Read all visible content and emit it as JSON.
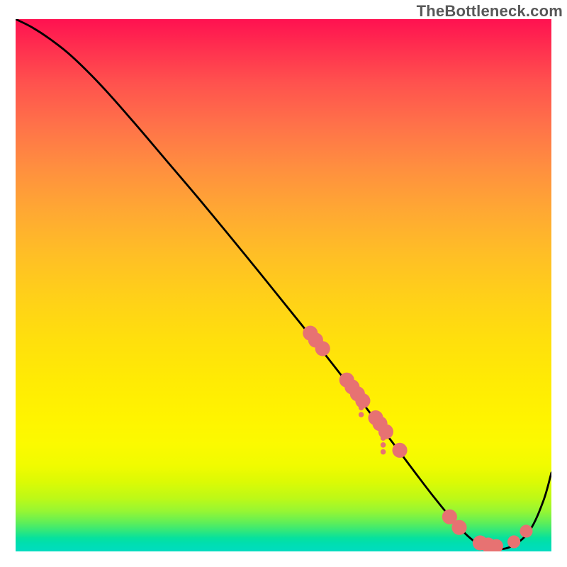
{
  "watermark": "TheBottleneck.com",
  "chart_data": {
    "type": "line",
    "title": "",
    "xlabel": "",
    "ylabel": "",
    "xlim": [
      0,
      1
    ],
    "ylim": [
      0,
      1
    ],
    "background_gradient": {
      "direction": "vertical_top_to_bottom",
      "stops": [
        {
          "pos": 0.0,
          "color": "#ff1150"
        },
        {
          "pos": 0.05,
          "color": "#ff2d4f"
        },
        {
          "pos": 0.12,
          "color": "#ff524e"
        },
        {
          "pos": 0.2,
          "color": "#ff7249"
        },
        {
          "pos": 0.28,
          "color": "#ff8f3f"
        },
        {
          "pos": 0.36,
          "color": "#ffa833"
        },
        {
          "pos": 0.44,
          "color": "#ffbe26"
        },
        {
          "pos": 0.52,
          "color": "#ffd019"
        },
        {
          "pos": 0.6,
          "color": "#ffdf0d"
        },
        {
          "pos": 0.68,
          "color": "#ffeb04"
        },
        {
          "pos": 0.75,
          "color": "#fff400"
        },
        {
          "pos": 0.8,
          "color": "#fbfa00"
        },
        {
          "pos": 0.84,
          "color": "#f0fb00"
        },
        {
          "pos": 0.87,
          "color": "#dbfa05"
        },
        {
          "pos": 0.9,
          "color": "#bdf917"
        },
        {
          "pos": 0.925,
          "color": "#95f634"
        },
        {
          "pos": 0.945,
          "color": "#61ef57"
        },
        {
          "pos": 0.962,
          "color": "#2fe77d"
        },
        {
          "pos": 0.975,
          "color": "#06e19e"
        },
        {
          "pos": 0.985,
          "color": "#00deb0"
        },
        {
          "pos": 1.0,
          "color": "#00dcc0"
        }
      ]
    },
    "series": [
      {
        "name": "bottleneck-curve",
        "color": "#000000",
        "stroke_width": 2.8,
        "x": [
          0.0,
          0.03,
          0.065,
          0.105,
          0.16,
          0.22,
          0.28,
          0.34,
          0.4,
          0.46,
          0.52,
          0.555,
          0.59,
          0.63,
          0.67,
          0.71,
          0.745,
          0.78,
          0.815,
          0.845,
          0.87,
          0.9,
          0.93,
          0.96,
          0.985,
          1.0
        ],
        "y": [
          1.0,
          0.985,
          0.962,
          0.93,
          0.875,
          0.807,
          0.736,
          0.665,
          0.592,
          0.518,
          0.443,
          0.399,
          0.354,
          0.302,
          0.249,
          0.196,
          0.149,
          0.103,
          0.06,
          0.028,
          0.011,
          0.004,
          0.012,
          0.04,
          0.095,
          0.148
        ]
      }
    ],
    "points": [
      {
        "name": "cluster-a-1",
        "x": 0.55,
        "y": 0.41,
        "r": 0.014,
        "color": "#e77272"
      },
      {
        "name": "cluster-a-2",
        "x": 0.56,
        "y": 0.397,
        "r": 0.014,
        "color": "#e77272"
      },
      {
        "name": "cluster-a-3",
        "x": 0.573,
        "y": 0.381,
        "r": 0.014,
        "color": "#e77272"
      },
      {
        "name": "cluster-b-1",
        "x": 0.618,
        "y": 0.322,
        "r": 0.014,
        "color": "#e77272"
      },
      {
        "name": "cluster-b-2",
        "x": 0.628,
        "y": 0.309,
        "r": 0.014,
        "color": "#e77272"
      },
      {
        "name": "cluster-b-3",
        "x": 0.638,
        "y": 0.296,
        "r": 0.014,
        "color": "#e77272"
      },
      {
        "name": "cluster-b-4",
        "x": 0.648,
        "y": 0.283,
        "r": 0.014,
        "color": "#e77272"
      },
      {
        "name": "cluster-c-1",
        "x": 0.672,
        "y": 0.251,
        "r": 0.014,
        "color": "#e77272"
      },
      {
        "name": "cluster-c-2",
        "x": 0.68,
        "y": 0.24,
        "r": 0.014,
        "color": "#e77272"
      },
      {
        "name": "cluster-c-3",
        "x": 0.691,
        "y": 0.225,
        "r": 0.014,
        "color": "#e77272"
      },
      {
        "name": "mid-1",
        "x": 0.717,
        "y": 0.19,
        "r": 0.014,
        "color": "#e77272"
      },
      {
        "name": "valley-1",
        "x": 0.81,
        "y": 0.065,
        "r": 0.014,
        "color": "#e77272"
      },
      {
        "name": "valley-2",
        "x": 0.828,
        "y": 0.045,
        "r": 0.014,
        "color": "#e77272"
      },
      {
        "name": "valley-3",
        "x": 0.867,
        "y": 0.016,
        "r": 0.014,
        "color": "#e77272"
      },
      {
        "name": "valley-4",
        "x": 0.882,
        "y": 0.012,
        "r": 0.014,
        "color": "#e77272"
      },
      {
        "name": "valley-5",
        "x": 0.897,
        "y": 0.01,
        "r": 0.013,
        "color": "#e77272"
      },
      {
        "name": "upslope-1",
        "x": 0.93,
        "y": 0.018,
        "r": 0.012,
        "color": "#e77272"
      },
      {
        "name": "upslope-2",
        "x": 0.953,
        "y": 0.038,
        "r": 0.012,
        "color": "#e77272"
      },
      {
        "name": "drip-a-1",
        "x": 0.686,
        "y": 0.213,
        "r": 0.005,
        "color": "#e77272"
      },
      {
        "name": "drip-a-2",
        "x": 0.686,
        "y": 0.2,
        "r": 0.005,
        "color": "#e77272"
      },
      {
        "name": "drip-a-3",
        "x": 0.686,
        "y": 0.187,
        "r": 0.005,
        "color": "#e77272"
      },
      {
        "name": "drip-b-1",
        "x": 0.645,
        "y": 0.27,
        "r": 0.005,
        "color": "#e77272"
      },
      {
        "name": "drip-b-2",
        "x": 0.645,
        "y": 0.257,
        "r": 0.005,
        "color": "#e77272"
      }
    ]
  }
}
